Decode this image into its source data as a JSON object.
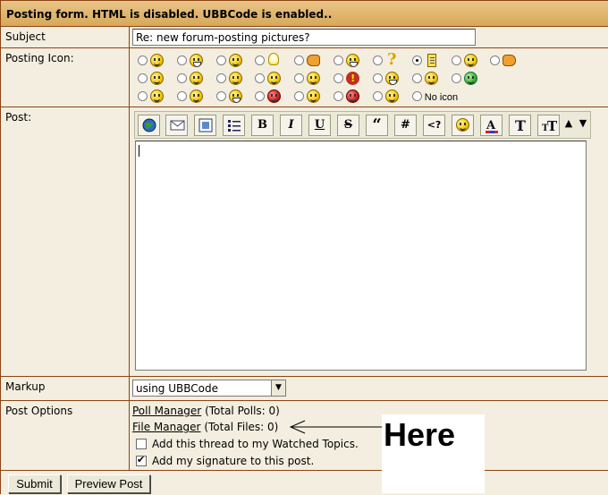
{
  "header": {
    "title": "Posting form. HTML is disabled. UBBCode is enabled.."
  },
  "subject": {
    "label": "Subject",
    "value": "Re: new forum-posting pictures?"
  },
  "posting_icon": {
    "label": "Posting Icon:",
    "rows": [
      [
        "smile",
        "grin-smiley",
        "tongue",
        "lightbulb",
        "thumbs-up",
        "laugh",
        "question",
        "document",
        "smirk",
        "thumbs-down"
      ],
      [
        "cool",
        "surprised",
        "wink",
        "sleepy",
        "rolleyes",
        "exclamation",
        "grin",
        "shocked",
        "green-sick"
      ],
      [
        "frown",
        "sunglasses",
        "crazy",
        "mad",
        "confused",
        "red-angry",
        "eek",
        "no-icon"
      ]
    ],
    "selected": "document",
    "no_icon_label": "No icon"
  },
  "post": {
    "label": "Post:",
    "toolbar": {
      "buttons": [
        "url-globe-icon",
        "email-icon",
        "image-icon",
        "list-icon",
        "bold",
        "italic",
        "underline",
        "strike",
        "quote",
        "code-hash",
        "html-tag",
        "smiley-icon",
        "font-color-icon",
        "font-face-icon",
        "font-size-icon"
      ],
      "bold": "B",
      "italic": "I",
      "underline": "U",
      "strike": "S",
      "quote": "“",
      "hash": "#",
      "tag": "<?"
    },
    "text": ""
  },
  "markup": {
    "label": "Markup",
    "selected": "using UBBCode"
  },
  "post_options": {
    "label": "Post Options",
    "poll_link": "Poll Manager",
    "poll_count": "(Total Polls: 0)",
    "file_link": "File Manager",
    "file_count": "(Total Files: 0)",
    "watch_label": "Add this thread to my Watched Topics.",
    "watch_checked": false,
    "signature_label": "Add my signature to this post.",
    "signature_checked": true
  },
  "annotation": {
    "text": "Here"
  },
  "buttons": {
    "submit": "Submit",
    "preview": "Preview Post"
  },
  "colors": {
    "header_bg": "#ddb268",
    "border": "#8b4513",
    "page_bg": "#f3eedf"
  }
}
